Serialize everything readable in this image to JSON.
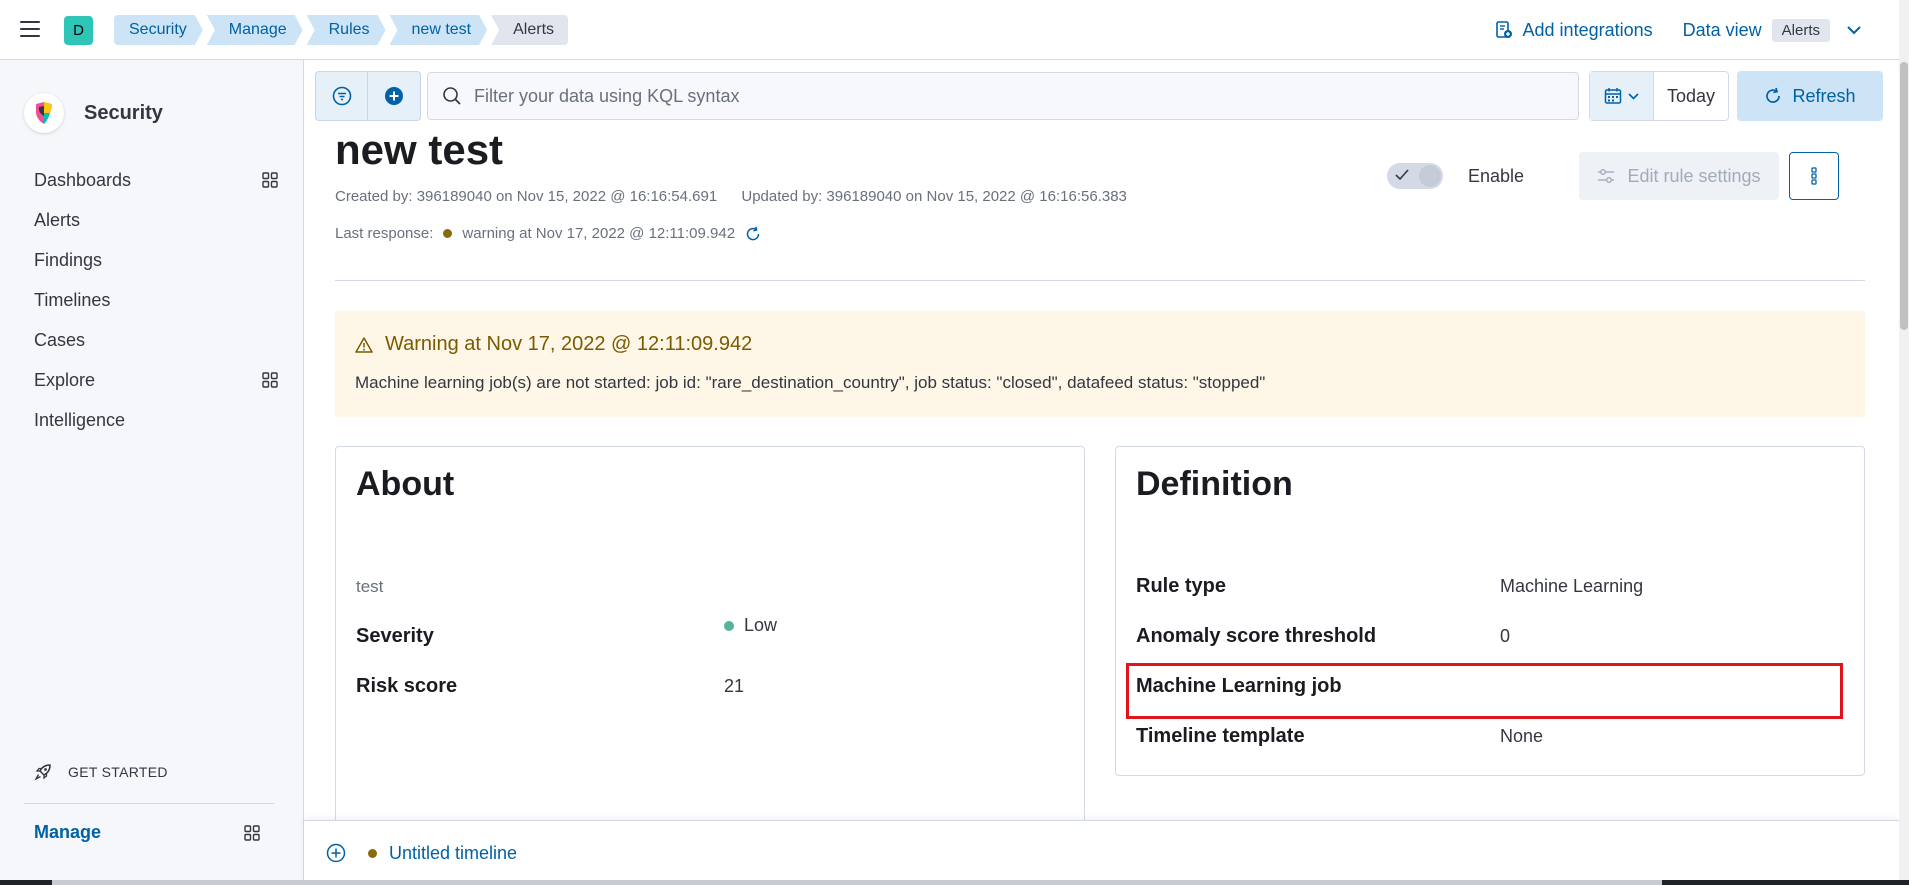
{
  "header": {
    "space_initial": "D",
    "breadcrumbs": [
      "Security",
      "Manage",
      "Rules",
      "new test",
      "Alerts"
    ],
    "add_integrations": "Add integrations",
    "data_view_label": "Data view",
    "data_view_value": "Alerts"
  },
  "sidebar": {
    "brand": "Security",
    "items": [
      {
        "label": "Dashboards",
        "icon": "app-grid-icon"
      },
      {
        "label": "Alerts",
        "icon": ""
      },
      {
        "label": "Findings",
        "icon": ""
      },
      {
        "label": "Timelines",
        "icon": ""
      },
      {
        "label": "Cases",
        "icon": ""
      },
      {
        "label": "Explore",
        "icon": "app-grid-icon"
      },
      {
        "label": "Intelligence",
        "icon": ""
      }
    ],
    "get_started": "GET STARTED",
    "manage": "Manage"
  },
  "query": {
    "placeholder": "Filter your data using KQL syntax",
    "date": "Today",
    "refresh": "Refresh"
  },
  "rule": {
    "title": "new test",
    "created": "Created by: 396189040 on Nov 15, 2022 @ 16:16:54.691",
    "updated": "Updated by: 396189040 on Nov 15, 2022 @ 16:16:56.383",
    "last_response_label": "Last response:",
    "last_response_value": "warning at Nov 17, 2022 @ 12:11:09.942",
    "enable_label": "Enable",
    "edit_label": "Edit rule settings"
  },
  "warning": {
    "title": "Warning at Nov 17, 2022 @ 12:11:09.942",
    "body": "Machine learning job(s) are not started: job id: \"rare_destination_country\", job status: \"closed\", datafeed status: \"stopped\""
  },
  "about": {
    "title": "About",
    "description": "test",
    "severity_label": "Severity",
    "severity_value": "Low",
    "risk_label": "Risk score",
    "risk_value": "21"
  },
  "definition": {
    "title": "Definition",
    "rows": [
      {
        "label": "Rule type",
        "value": "Machine Learning"
      },
      {
        "label": "Anomaly score threshold",
        "value": "0"
      },
      {
        "label": "Machine Learning job",
        "value": ""
      },
      {
        "label": "Timeline template",
        "value": "None"
      }
    ]
  },
  "timeline": {
    "name": "Untitled timeline"
  },
  "colors": {
    "accent": "#0061a6",
    "warning_dot": "#8a6a0a",
    "severity_low": "#54b399",
    "highlight": "#e0151c"
  }
}
